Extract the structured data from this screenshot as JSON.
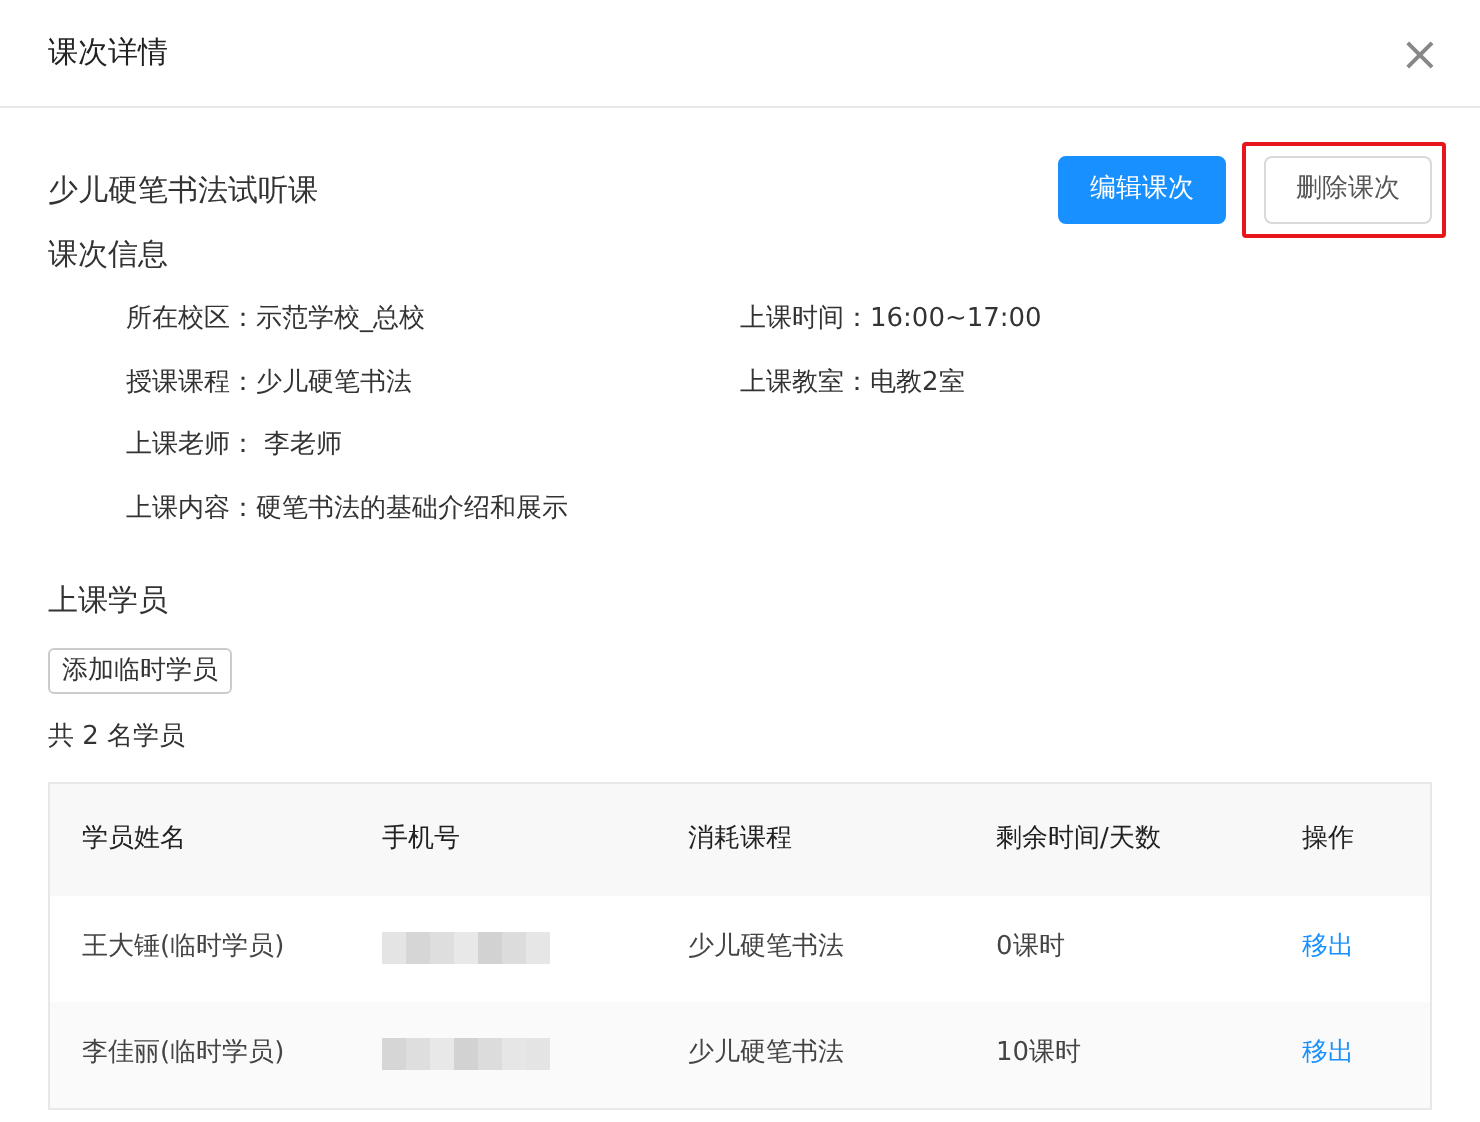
{
  "dialog": {
    "title": "课次详情",
    "close": "×"
  },
  "lesson": {
    "name": "少儿硬笔书法试听课"
  },
  "buttons": [
    {
      "label": "编辑课次",
      "kind": "primary",
      "highlighted": false
    },
    {
      "label": "删除课次",
      "kind": "default",
      "highlighted": true
    }
  ],
  "info": {
    "heading": "课次信息",
    "rows": [
      [
        {
          "label": "所在校区：",
          "value": "示范学校_总校"
        },
        {
          "label": "上课时间：",
          "value": "16:00~17:00"
        }
      ],
      [
        {
          "label": "授课课程：",
          "value": "少儿硬笔书法"
        },
        {
          "label": "上课教室：",
          "value": "电教2室"
        }
      ],
      [
        {
          "label": "上课老师：",
          "value": " 李老师"
        }
      ],
      [
        {
          "label": "上课内容：",
          "value": "硬笔书法的基础介绍和展示"
        }
      ]
    ]
  },
  "students": {
    "heading": "上课学员",
    "add_button": "添加临时学员",
    "count": "共 2 名学员",
    "columns": [
      "学员姓名",
      "手机号",
      "消耗课程",
      "剩余时间/天数",
      "操作"
    ],
    "rows": [
      {
        "name": "王大锤(临时学员)",
        "phone_redacted": true,
        "course": "少儿硬笔书法",
        "remaining": "0课时",
        "action": "移出"
      },
      {
        "name": "李佳丽(临时学员)",
        "phone_redacted": true,
        "course": "少儿硬笔书法",
        "remaining": "10课时",
        "action": "移出"
      }
    ]
  }
}
